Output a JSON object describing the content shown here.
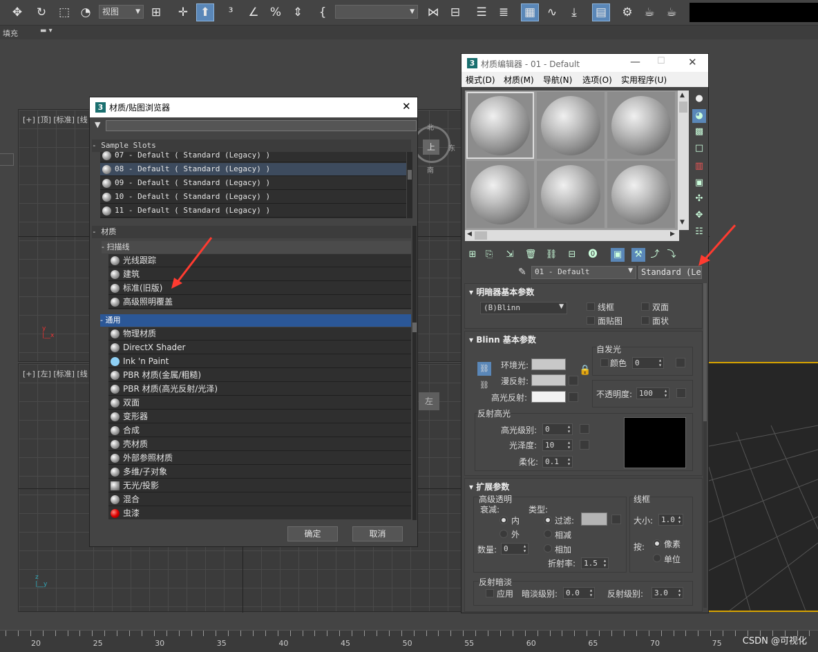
{
  "toolbar": {
    "view_dropdown": "视图"
  },
  "row2": {
    "fill_label": "填充"
  },
  "viewports": {
    "top_label": "[+] [顶] [标准] [线",
    "left_label": "[+] [左] [标准] [线",
    "compass_top": "北",
    "compass_right": "东",
    "compass_bottom": "南",
    "cube_top": "上",
    "cube_left": "左"
  },
  "timeline": {
    "ticks": [
      "20",
      "25",
      "30",
      "35",
      "40",
      "45",
      "50",
      "55",
      "60",
      "65",
      "70",
      "75"
    ]
  },
  "watermark": "CSDN @可视化",
  "browser": {
    "icon": "3",
    "title": "材质/贴图浏览器",
    "close": "✕",
    "sample_slots": {
      "header": "- Sample Slots",
      "items": [
        "07 - Default  ( Standard (Legacy) )",
        "08 - Default  ( Standard (Legacy) )",
        "09 - Default  ( Standard (Legacy) )",
        "10 - Default  ( Standard (Legacy) )",
        "11 - Default  ( Standard (Legacy) )"
      ]
    },
    "materials_header": "- 材质",
    "scanline": {
      "header": "- 扫描线",
      "items": [
        "光线跟踪",
        "建筑",
        "标准(旧版)",
        "高级照明覆盖"
      ]
    },
    "general": {
      "header": "- 通用",
      "items": [
        "物理材质",
        "DirectX Shader",
        "Ink 'n Paint",
        "PBR 材质(金属/粗糙)",
        "PBR 材质(高光反射/光泽)",
        "双面",
        "变形器",
        "合成",
        "壳材质",
        "外部参照材质",
        "多维/子对象",
        "无光/投影",
        "混合",
        "虫漆"
      ]
    },
    "ok": "确定",
    "cancel": "取消"
  },
  "editor": {
    "icon": "3",
    "title": "材质编辑器 - 01 - Default",
    "menu": [
      "模式(D)",
      "材质(M)",
      "导航(N)",
      "选项(O)",
      "实用程序(U)"
    ],
    "material_name": "01 - Default",
    "material_type": "Standard (Legac",
    "shader_basic": {
      "title": "明暗器基本参数",
      "shader": "(B)Blinn",
      "wire": "线框",
      "two_sided": "双面",
      "face_map": "面贴图",
      "faceted": "面状"
    },
    "blinn_basic": {
      "title": "Blinn 基本参数",
      "self_illum": "自发光",
      "color": "颜色",
      "color_value": "0",
      "ambient": "环境光:",
      "diffuse": "漫反射:",
      "specular": "高光反射:",
      "opacity": "不透明度:",
      "opacity_value": "100",
      "spec_highlights": "反射高光",
      "spec_level": "高光级别:",
      "spec_level_value": "0",
      "glossiness": "光泽度:",
      "glossiness_value": "10",
      "soften": "柔化:",
      "soften_value": "0.1"
    },
    "extended": {
      "title": "扩展参数",
      "adv_transp": "高级透明",
      "falloff": "衰减:",
      "in": "内",
      "out": "外",
      "amount": "数量:",
      "amount_value": "0",
      "type": "类型:",
      "filter": "过滤:",
      "subtractive": "相减",
      "additive": "相加",
      "ior": "折射率:",
      "ior_value": "1.5",
      "wire": "线框",
      "size": "大小:",
      "size_value": "1.0",
      "in_label": "按:",
      "pixels": "像素",
      "units": "单位",
      "refl_dimming": "反射暗淡",
      "apply": "应用",
      "dim_level": "暗淡级别:",
      "dim_value": "0.0",
      "refl_level": "反射级别:",
      "refl_value": "3.0"
    }
  },
  "colors": {
    "accent_blue": "#2b5797",
    "arrow_red": "#ff3b30",
    "ambient_swatch": "#c8c8c8",
    "specular_swatch": "#f2f2f2",
    "filter_swatch": "#b4b4b4"
  }
}
